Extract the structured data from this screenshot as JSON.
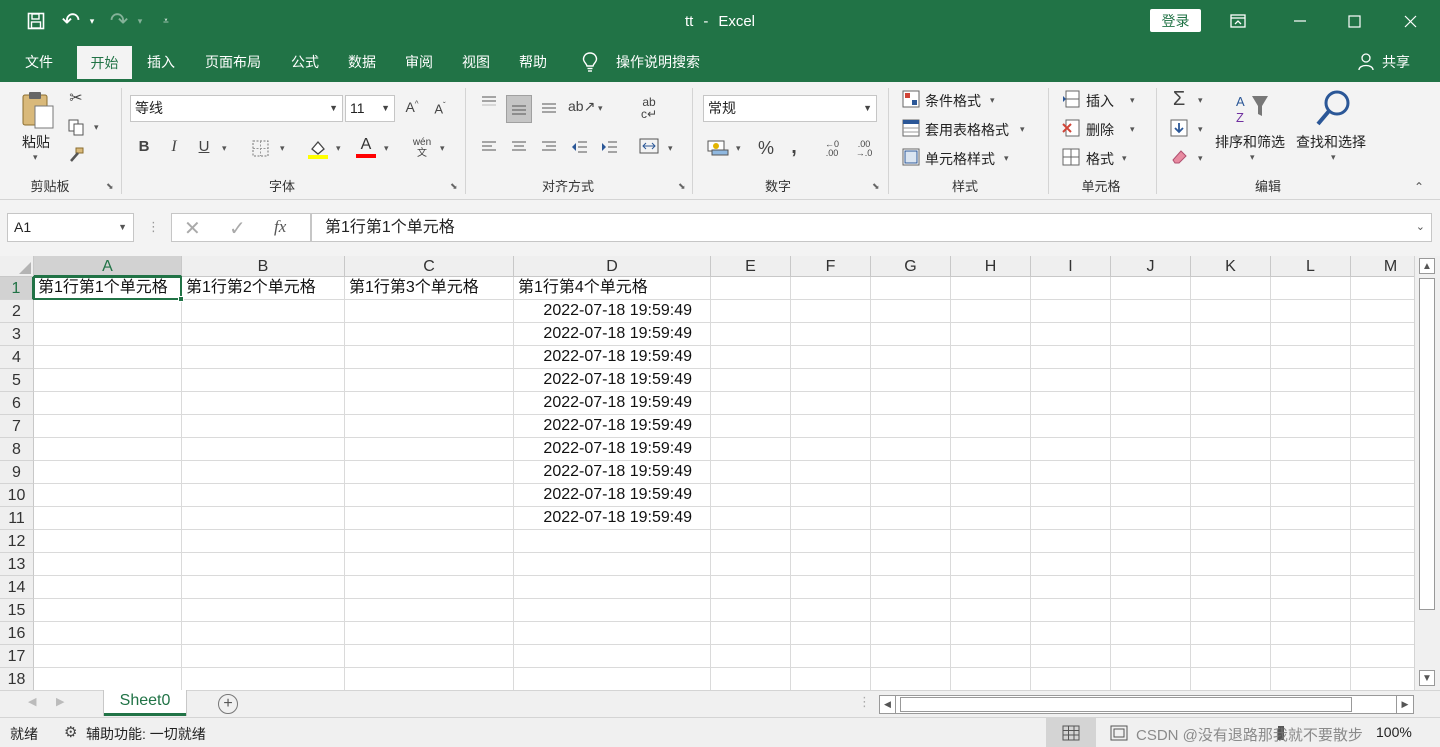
{
  "title": {
    "filename": "tt",
    "separator": "-",
    "app": "Excel",
    "login_label": "登录"
  },
  "menu": {
    "tabs": [
      "文件",
      "开始",
      "插入",
      "页面布局",
      "公式",
      "数据",
      "审阅",
      "视图",
      "帮助"
    ],
    "active_tab": "开始",
    "tell_me": "操作说明搜索",
    "share": "共享"
  },
  "ribbon": {
    "clipboard": {
      "paste": "粘贴",
      "group": "剪贴板"
    },
    "font": {
      "name": "等线",
      "size": "11",
      "bold": "B",
      "italic": "I",
      "underline": "U",
      "group": "字体",
      "fill_color": "#ffff00",
      "font_color": "#ff0000"
    },
    "alignment": {
      "group": "对齐方式"
    },
    "number": {
      "format": "常规",
      "percent": "%",
      "comma": ",",
      "group": "数字"
    },
    "styles": {
      "conditional": "条件格式",
      "table": "套用表格格式",
      "cell_styles": "单元格样式",
      "group": "样式"
    },
    "cells": {
      "insert": "插入",
      "delete": "删除",
      "format": "格式",
      "group": "单元格"
    },
    "editing": {
      "sort_filter": "排序和筛选",
      "find_select": "查找和选择",
      "group": "编辑"
    }
  },
  "formula_bar": {
    "name_box": "A1",
    "fx": "fx",
    "content": "第1行第1个单元格"
  },
  "columns": [
    "A",
    "B",
    "C",
    "D",
    "E",
    "F",
    "G",
    "H",
    "I",
    "J",
    "K",
    "L",
    "M"
  ],
  "rows": [
    "1",
    "2",
    "3",
    "4",
    "5",
    "6",
    "7",
    "8",
    "9",
    "10",
    "11",
    "12",
    "13",
    "14",
    "15",
    "16",
    "17",
    "18"
  ],
  "cells": {
    "A1": "第1行第1个单元格",
    "B1": "第1行第2个单元格",
    "C1": "第1行第3个单元格",
    "D1": "第1行第4个单元格",
    "D2": "2022-07-18 19:59:49",
    "D3": "2022-07-18 19:59:49",
    "D4": "2022-07-18 19:59:49",
    "D5": "2022-07-18 19:59:49",
    "D6": "2022-07-18 19:59:49",
    "D7": "2022-07-18 19:59:49",
    "D8": "2022-07-18 19:59:49",
    "D9": "2022-07-18 19:59:49",
    "D10": "2022-07-18 19:59:49",
    "D11": "2022-07-18 19:59:49"
  },
  "selected_cell": "A1",
  "sheets": {
    "tabs": [
      "Sheet0"
    ],
    "active": "Sheet0"
  },
  "status": {
    "ready": "就绪",
    "accessibility": "辅助功能: 一切就绪",
    "zoom": "100%",
    "watermark": "CSDN @没有退路那我就不要散步"
  },
  "colors": {
    "brand": "#217346"
  }
}
